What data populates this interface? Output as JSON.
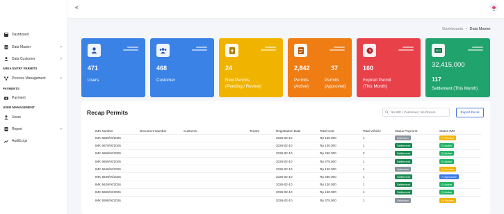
{
  "sidebar": {
    "items": [
      {
        "label": "Dashboard",
        "icon": "dashboard-icon"
      },
      {
        "label": "Data Master",
        "icon": "database-icon",
        "has_chevron": true
      },
      {
        "label": "Data Customer",
        "icon": "user-tie-icon",
        "has_chevron": true
      },
      {
        "label": "Process Management",
        "icon": "process-icon",
        "has_chevron": true
      },
      {
        "label": "Payment",
        "icon": "money-icon"
      },
      {
        "label": "Users",
        "icon": "user-icon"
      },
      {
        "label": "Report",
        "icon": "report-icon",
        "has_chevron": true
      },
      {
        "label": "AuditLogs",
        "icon": "audit-icon"
      }
    ],
    "sections": [
      "AREA ENTRY PERMITS",
      "PAYMENTS",
      "USER MANAGEMENT"
    ]
  },
  "topbar": {
    "collapse_label": "«",
    "avatar_icon": "user-avatar-icon"
  },
  "breadcrumb": {
    "parent": "Dashboards",
    "separator": "•",
    "current": "Data Master"
  },
  "cards": [
    {
      "value": "471",
      "label": "Users",
      "color": "#3b82e6",
      "icon": "user-icon"
    },
    {
      "value": "468",
      "label": "Customer",
      "color": "#3b82e6",
      "icon": "users-icon"
    },
    {
      "value": "24",
      "label_line1": "New Permits",
      "label_line2": "(Pending / Review)",
      "color": "#f0b400",
      "icon": "file-upload-icon"
    },
    {
      "value1": "2,842",
      "value2": "37",
      "label1_line1": "Permits",
      "label1_line2": "(Active)",
      "label2_line1": "Permits",
      "label2_line2": "(Approved)",
      "color": "#f07c14",
      "icon": "document-icon"
    },
    {
      "value": "160",
      "label_line1": "Expired Permit",
      "label_line2": "(This Month)",
      "color": "#e8414a",
      "icon": "clock-icon"
    },
    {
      "value": "32,415,000",
      "value2": "117",
      "label": "Settlement (This Month)",
      "color": "#21a36e",
      "icon": "money-bill-icon"
    }
  ],
  "recap": {
    "title": "Recap Permits",
    "search_placeholder": "No IMK | Customer | No Docum",
    "export_label": "Export Excel",
    "columns": [
      "IMK Number",
      "Document Number",
      "Customer",
      "Tenant",
      "Registration Date",
      "Total Cost",
      "Total Vehicle",
      "Status Payment",
      "Status IMK"
    ],
    "rows": [
      {
        "imk": "IMK 5686/IX/2026",
        "doc": "",
        "customer": "",
        "tenant": "",
        "date": "2026-02-10",
        "cost": "Rp 150.000",
        "vehicle": "1",
        "payment": "Unknown",
        "imk_status": "Review"
      },
      {
        "imk": "IMK 5679/IX/2026",
        "doc": "",
        "customer": "",
        "tenant": "",
        "date": "2026-02-10",
        "cost": "Rp 130.000",
        "vehicle": "1",
        "payment": "Settlement",
        "imk_status": "Active"
      },
      {
        "imk": "IMK 5668/IX/2026",
        "doc": "",
        "customer": "",
        "tenant": "",
        "date": "2026-02-10",
        "cost": "Rp 260.000",
        "vehicle": "2",
        "payment": "Settlement",
        "imk_status": "Active"
      },
      {
        "imk": "IMK 5659/IX/2026",
        "doc": "",
        "customer": "",
        "tenant": "",
        "date": "2026-02-10",
        "cost": "Rp 375.000",
        "vehicle": "1",
        "payment": "Settlement",
        "imk_status": "Active"
      },
      {
        "imk": "IMK 5649/IX/2026",
        "doc": "",
        "customer": "",
        "tenant": "",
        "date": "2026-02-10",
        "cost": "Rp 150.000",
        "vehicle": "1",
        "payment": "Unknown",
        "imk_status": "Review"
      },
      {
        "imk": "IMK 5639/IX/2026",
        "doc": "",
        "customer": "",
        "tenant": "",
        "date": "2026-02-10",
        "cost": "Rp 360.000",
        "vehicle": "1",
        "payment": "Settlement",
        "imk_status": "Approved"
      },
      {
        "imk": "IMK 5629/IX/2026",
        "doc": "",
        "customer": "",
        "tenant": "",
        "date": "2026-02-10",
        "cost": "Rp 130.000",
        "vehicle": "1",
        "payment": "Settlement",
        "imk_status": "Active"
      },
      {
        "imk": "IMK 5609/IX/2026",
        "doc": "",
        "customer": "",
        "tenant": "",
        "date": "2026-02-10",
        "cost": "Rp 150.000",
        "vehicle": "1",
        "payment": "Settlement",
        "imk_status": "Active"
      },
      {
        "imk": "IMK 5598/IX/2026",
        "doc": "",
        "customer": "",
        "tenant": "",
        "date": "2026-02-10",
        "cost": "Rp 375.000",
        "vehicle": "1",
        "payment": "Unknown",
        "imk_status": "Review"
      }
    ]
  },
  "status_colors": {
    "Unknown": "#8a939c",
    "Settlement": "#1a8a52",
    "Review": "#f2b400",
    "Active": "#24b466",
    "Approved": "#3a78e8"
  }
}
